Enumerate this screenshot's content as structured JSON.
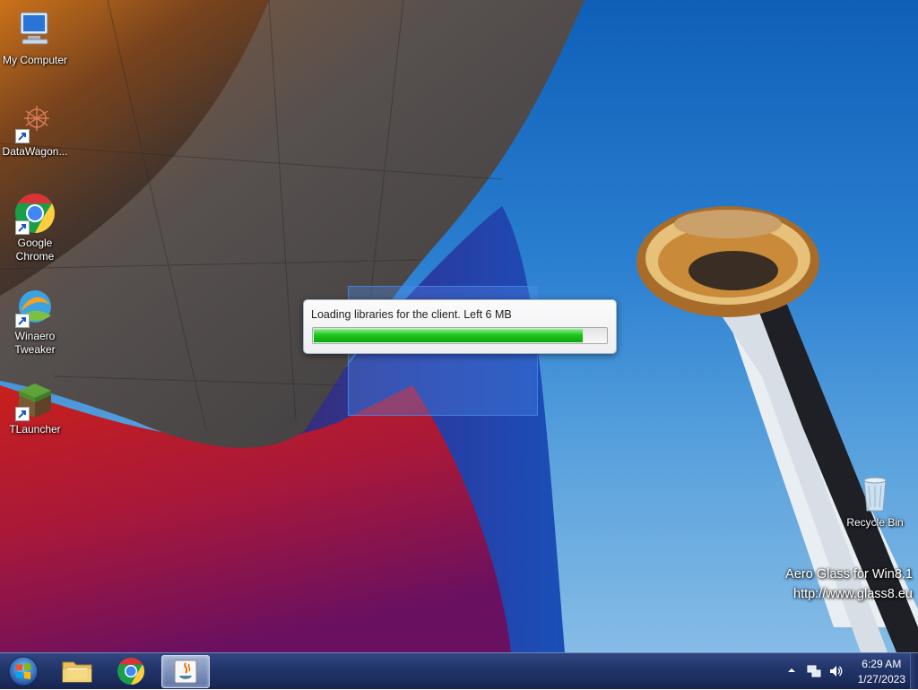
{
  "desktop": {
    "icons": [
      {
        "label": "My Computer",
        "icon": "computer-icon"
      },
      {
        "label": "DataWagon...",
        "icon": "datawagon-icon"
      },
      {
        "label": "Google\nChrome",
        "icon": "chrome-icon"
      },
      {
        "label": "Winaero\nTweaker",
        "icon": "winaero-icon"
      },
      {
        "label": "TLauncher",
        "icon": "grass-block-icon"
      },
      {
        "label": "Recycle Bin",
        "icon": "recycle-bin-icon"
      }
    ]
  },
  "dialog": {
    "message": "Loading libraries for the client. Left 6 MB",
    "progress": 0.92
  },
  "watermark": {
    "line1": "Aero Glass for Win8.1",
    "line2": "http://www.glass8.eu"
  },
  "taskbar": {
    "items": [
      {
        "icon": "start-orb-icon"
      },
      {
        "icon": "file-explorer-icon"
      },
      {
        "icon": "chrome-icon"
      },
      {
        "icon": "java-icon",
        "active": true
      }
    ],
    "tray": {
      "icons": [
        "show-hidden-icons-arrow",
        "network-icon",
        "volume-icon"
      ],
      "time": "6:29 AM",
      "date": "1/27/2023"
    }
  },
  "colors": {
    "taskbar": "#22356a",
    "progress_green": "#1fc41f",
    "selection": "#508ceb"
  }
}
